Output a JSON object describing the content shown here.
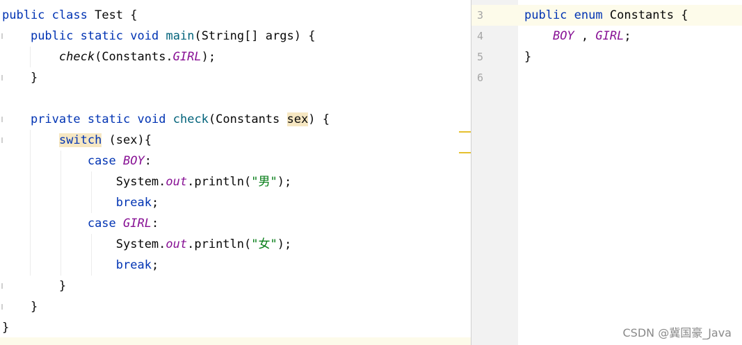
{
  "left_editor": {
    "lines": [
      {
        "tokens": [
          {
            "t": "public",
            "c": "kw"
          },
          {
            "t": " "
          },
          {
            "t": "class",
            "c": "kw"
          },
          {
            "t": " Test {"
          }
        ]
      },
      {
        "tokens": [
          {
            "t": "    "
          },
          {
            "t": "public",
            "c": "kw"
          },
          {
            "t": " "
          },
          {
            "t": "static",
            "c": "kw"
          },
          {
            "t": " "
          },
          {
            "t": "void",
            "c": "kw"
          },
          {
            "t": " "
          },
          {
            "t": "main",
            "c": "fn"
          },
          {
            "t": "(String[] args) {"
          }
        ]
      },
      {
        "tokens": [
          {
            "t": "        "
          },
          {
            "t": "check",
            "c": "it"
          },
          {
            "t": "(Constants."
          },
          {
            "t": "GIRL",
            "c": "cst"
          },
          {
            "t": ");"
          }
        ]
      },
      {
        "tokens": [
          {
            "t": "    }"
          }
        ]
      },
      {
        "tokens": []
      },
      {
        "tokens": [
          {
            "t": "    "
          },
          {
            "t": "private",
            "c": "kw"
          },
          {
            "t": " "
          },
          {
            "t": "static",
            "c": "kw"
          },
          {
            "t": " "
          },
          {
            "t": "void",
            "c": "kw"
          },
          {
            "t": " "
          },
          {
            "t": "check",
            "c": "fn"
          },
          {
            "t": "(Constants "
          },
          {
            "t": "sex",
            "c": "hl"
          },
          {
            "t": ") {"
          }
        ]
      },
      {
        "tokens": [
          {
            "t": "        "
          },
          {
            "t": "switch",
            "c": "kw hl"
          },
          {
            "t": " (sex){"
          }
        ]
      },
      {
        "tokens": [
          {
            "t": "            "
          },
          {
            "t": "case",
            "c": "kw"
          },
          {
            "t": " "
          },
          {
            "t": "BOY",
            "c": "cst"
          },
          {
            "t": ":"
          }
        ]
      },
      {
        "tokens": [
          {
            "t": "                System."
          },
          {
            "t": "out",
            "c": "cst"
          },
          {
            "t": ".println("
          },
          {
            "t": "\"男\"",
            "c": "str"
          },
          {
            "t": ");"
          }
        ]
      },
      {
        "tokens": [
          {
            "t": "                "
          },
          {
            "t": "break",
            "c": "kw"
          },
          {
            "t": ";"
          }
        ]
      },
      {
        "tokens": [
          {
            "t": "            "
          },
          {
            "t": "case",
            "c": "kw"
          },
          {
            "t": " "
          },
          {
            "t": "GIRL",
            "c": "cst"
          },
          {
            "t": ":"
          }
        ]
      },
      {
        "tokens": [
          {
            "t": "                System."
          },
          {
            "t": "out",
            "c": "cst"
          },
          {
            "t": ".println("
          },
          {
            "t": "\"女\"",
            "c": "str"
          },
          {
            "t": ");"
          }
        ]
      },
      {
        "tokens": [
          {
            "t": "                "
          },
          {
            "t": "break",
            "c": "kw"
          },
          {
            "t": ";"
          }
        ]
      },
      {
        "tokens": [
          {
            "t": "        }"
          }
        ]
      },
      {
        "tokens": [
          {
            "t": "    }"
          }
        ]
      },
      {
        "tokens": [
          {
            "t": "}"
          }
        ]
      }
    ]
  },
  "right_editor": {
    "line_numbers": [
      "3",
      "4",
      "5",
      "6"
    ],
    "lines": [
      {
        "tokens": [
          {
            "t": "public",
            "c": "kw"
          },
          {
            "t": " "
          },
          {
            "t": "enum",
            "c": "kw"
          },
          {
            "t": " Constants {"
          }
        ]
      },
      {
        "tokens": [
          {
            "t": "    "
          },
          {
            "t": "BOY",
            "c": "cst"
          },
          {
            "t": " , "
          },
          {
            "t": "GIRL",
            "c": "cst"
          },
          {
            "t": ";"
          }
        ]
      },
      {
        "tokens": [
          {
            "t": "}"
          }
        ]
      },
      {
        "tokens": []
      }
    ]
  },
  "watermark": "CSDN @冀国豪_Java",
  "colors": {
    "keyword": "#0033b3",
    "method": "#00627a",
    "constant": "#871094",
    "string": "#067d17",
    "usage_highlight": "#f6e7c2",
    "current_line": "#fdfbea",
    "marker": "#e5c02e"
  }
}
